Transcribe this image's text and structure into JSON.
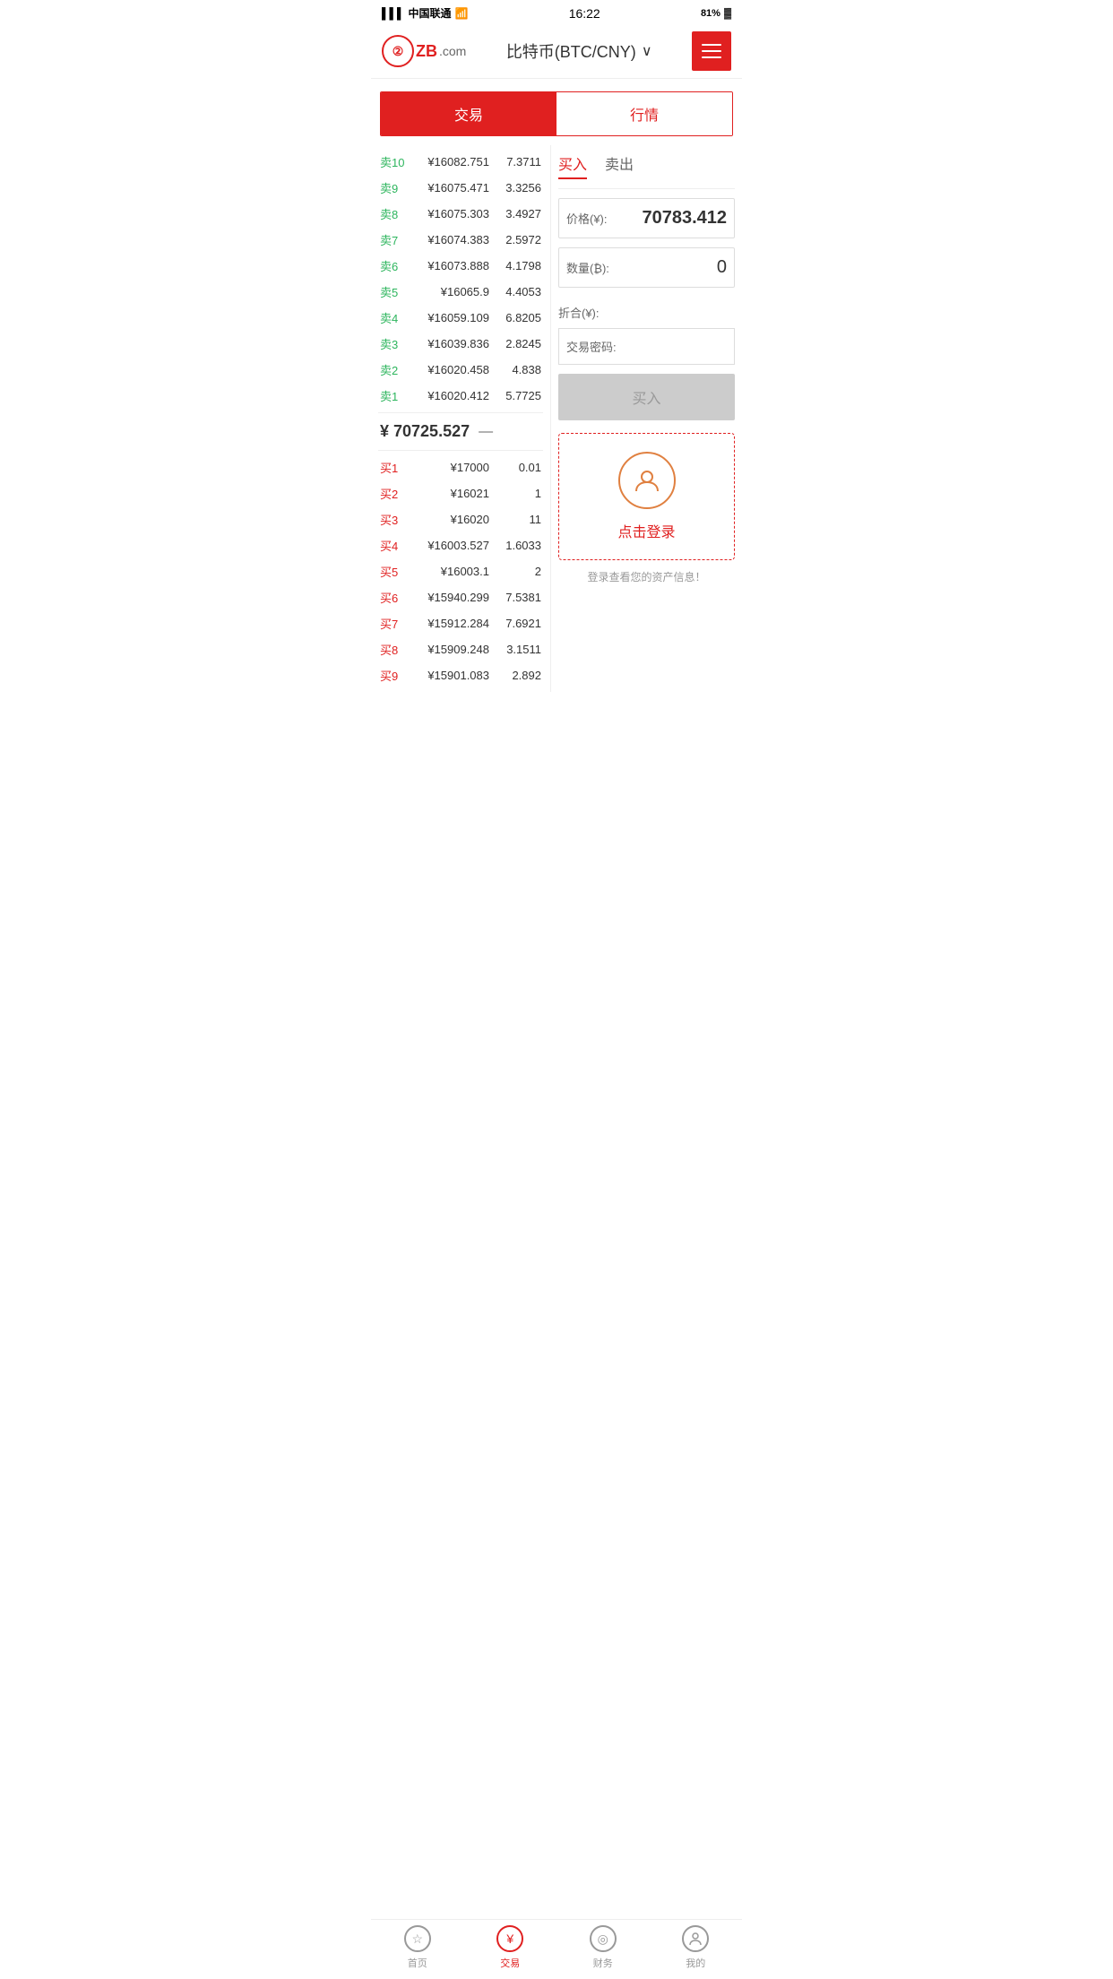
{
  "statusBar": {
    "carrier": "中国联通",
    "time": "16:22",
    "battery": "81%"
  },
  "header": {
    "logo": "ZB",
    "logoDomain": ".com",
    "title": "比特币(BTC/CNY)",
    "menuLabel": "menu"
  },
  "tabs": {
    "trade": "交易",
    "market": "行情"
  },
  "orderBook": {
    "sells": [
      {
        "label": "卖10",
        "price": "¥16082.751",
        "qty": "7.3711"
      },
      {
        "label": "卖9",
        "price": "¥16075.471",
        "qty": "3.3256"
      },
      {
        "label": "卖8",
        "price": "¥16075.303",
        "qty": "3.4927"
      },
      {
        "label": "卖7",
        "price": "¥16074.383",
        "qty": "2.5972"
      },
      {
        "label": "卖6",
        "price": "¥16073.888",
        "qty": "4.1798"
      },
      {
        "label": "卖5",
        "price": "¥16065.9",
        "qty": "4.4053"
      },
      {
        "label": "卖4",
        "price": "¥16059.109",
        "qty": "6.8205"
      },
      {
        "label": "卖3",
        "price": "¥16039.836",
        "qty": "2.8245"
      },
      {
        "label": "卖2",
        "price": "¥16020.458",
        "qty": "4.838"
      },
      {
        "label": "卖1",
        "price": "¥16020.412",
        "qty": "5.7725"
      }
    ],
    "midPrice": "¥ 70725.527",
    "midIcon": "—",
    "buys": [
      {
        "label": "买1",
        "price": "¥17000",
        "qty": "0.01"
      },
      {
        "label": "买2",
        "price": "¥16021",
        "qty": "1"
      },
      {
        "label": "买3",
        "price": "¥16020",
        "qty": "11"
      },
      {
        "label": "买4",
        "price": "¥16003.527",
        "qty": "1.6033"
      },
      {
        "label": "买5",
        "price": "¥16003.1",
        "qty": "2"
      },
      {
        "label": "买6",
        "price": "¥15940.299",
        "qty": "7.5381"
      },
      {
        "label": "买7",
        "price": "¥15912.284",
        "qty": "7.6921"
      },
      {
        "label": "买8",
        "price": "¥15909.248",
        "qty": "3.1511"
      },
      {
        "label": "买9",
        "price": "¥15901.083",
        "qty": "2.892"
      }
    ]
  },
  "tradePanel": {
    "buyTab": "买入",
    "sellTab": "卖出",
    "priceLabel": "价格(¥):",
    "priceValue": "70783.412",
    "qtyLabel": "数量(₿):",
    "qtyValue": "0",
    "totalLabel": "折合(¥):",
    "totalValue": "",
    "passwordLabel": "交易密码:",
    "buyBtn": "买入"
  },
  "loginPrompt": {
    "text": "点击登录",
    "hint": "登录查看您的资产信息！"
  },
  "bottomNav": [
    {
      "label": "首页",
      "icon": "☆",
      "active": false
    },
    {
      "label": "交易",
      "icon": "¥",
      "active": true
    },
    {
      "label": "财务",
      "icon": "◎",
      "active": false
    },
    {
      "label": "我的",
      "icon": "👤",
      "active": false
    }
  ]
}
